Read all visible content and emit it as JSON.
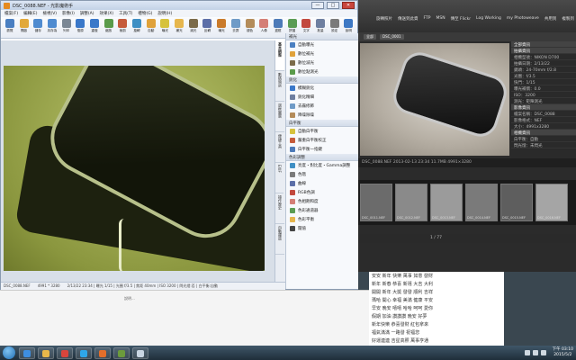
{
  "editor": {
    "title": "DSC_0088.NEF - 光影魔術手",
    "window_buttons": [
      "—",
      "□",
      "✕"
    ],
    "menu": [
      "檔案(F)",
      "編輯(E)",
      "檢視(V)",
      "影像(I)",
      "調整(A)",
      "效果(X)",
      "工具(T)",
      "禮物(G)",
      "說明(H)"
    ],
    "tools": [
      {
        "label": "瀏覽",
        "color": "#4a7fc1"
      },
      {
        "label": "開啟",
        "color": "#e2a93a"
      },
      {
        "label": "儲存",
        "color": "#4f8bd0"
      },
      {
        "label": "另存為",
        "color": "#4f8bd0"
      },
      {
        "label": "列印",
        "color": "#7b8794"
      },
      {
        "label": "復原",
        "color": "#3a78c9"
      },
      {
        "label": "重做",
        "color": "#3a78c9"
      },
      {
        "label": "縮放",
        "color": "#5a9b4a"
      },
      {
        "label": "裁剪",
        "color": "#c65b3b"
      },
      {
        "label": "旋轉",
        "color": "#3f8fc4"
      },
      {
        "label": "自動",
        "color": "#e0a23a"
      },
      {
        "label": "曝光",
        "color": "#d6c23d"
      },
      {
        "label": "補光",
        "color": "#e6b64d"
      },
      {
        "label": "減光",
        "color": "#7b6b4a"
      },
      {
        "label": "反轉",
        "color": "#5c6fa8"
      },
      {
        "label": "曝光",
        "color": "#ca7b2b"
      },
      {
        "label": "去霧",
        "color": "#6f9bc7"
      },
      {
        "label": "褪色",
        "color": "#b48c5a"
      },
      {
        "label": "人像",
        "color": "#d47e76"
      },
      {
        "label": "邊框",
        "color": "#4d7ab8"
      },
      {
        "label": "拼圖",
        "color": "#5b9c54"
      },
      {
        "label": "文字",
        "color": "#c2493e"
      },
      {
        "label": "批量",
        "color": "#6e7fa0"
      },
      {
        "label": "設定",
        "color": "#7a7a7a"
      },
      {
        "label": "說明",
        "color": "#3d78c4"
      }
    ],
    "vtabs": [
      "基本調整",
      "數碼暗房",
      "邊框圖層",
      "便捷工具",
      "EXIF",
      "操作歷史",
      "自動擺放"
    ],
    "panel": {
      "sections": [
        {
          "title": "補光",
          "items": [
            {
              "label": "自動曝光",
              "color": "#4a7fc1"
            },
            {
              "label": "數位補光",
              "color": "#e0a23a"
            },
            {
              "label": "數位減光",
              "color": "#7b6b4a"
            },
            {
              "label": "數位點測光",
              "color": "#5a9b4a"
            }
          ]
        },
        {
          "title": "銳化",
          "items": [
            {
              "label": "模糊銳化",
              "color": "#3a78c9"
            },
            {
              "label": "銳化精細",
              "color": "#6e7fa0"
            },
            {
              "label": "去霧修飾",
              "color": "#6f9bc7"
            },
            {
              "label": "降噪除噪",
              "color": "#b48c5a"
            }
          ]
        },
        {
          "title": "白平衡",
          "items": [
            {
              "label": "自動白平衡",
              "color": "#d6c23d"
            },
            {
              "label": "嚴重白平衡校正",
              "color": "#c65b3b"
            },
            {
              "label": "白平衡一指鍵",
              "color": "#4d7ab8"
            }
          ]
        },
        {
          "title": "色彩調整",
          "items": [
            {
              "label": "亮度・對比度・Gamma調整",
              "color": "#3f8fc4"
            },
            {
              "label": "色階",
              "color": "#7a7a7a"
            },
            {
              "label": "曲線",
              "color": "#5c6fa8"
            },
            {
              "label": "RGB色調",
              "color": "#c2493e"
            },
            {
              "label": "色相飽和度",
              "color": "#d47e76"
            },
            {
              "label": "色彩通道器",
              "color": "#5b9c54"
            },
            {
              "label": "色彩平衡",
              "color": "#e6b64d"
            },
            {
              "label": "閾值",
              "color": "#444444"
            }
          ]
        }
      ]
    },
    "status": [
      "DSC_0088.NEF",
      "4991 * 3280",
      "2/13/22 23:34 | 曝光 1/15 | 光圈 f/3.5 | 焦距 40mm | ISO 3200 | 閃光燈:否 | 白平衡:自動"
    ]
  },
  "viewer": {
    "toolbar": [
      "旋轉照片",
      "傳送到此資",
      "FTP",
      "MSN",
      "傳至 Flickr",
      "Log Working",
      "my Photoweave",
      "共用到",
      "複製到",
      "另外存"
    ],
    "subtabs": [
      "全部",
      "DSC_0001"
    ],
    "info": [
      {
        "text": "全部資訊",
        "header": true
      },
      {
        "text": "拍攝資訊",
        "header": true
      },
      {
        "text": "相機型號：NIKON D700",
        "header": false
      },
      {
        "text": "拍攝日期：2/13/22",
        "header": false
      },
      {
        "text": "鏡頭：24-70mm f/2.8",
        "header": false
      },
      {
        "text": "光圈：f/3.5",
        "header": false
      },
      {
        "text": "快門：1/15",
        "header": false
      },
      {
        "text": "曝光補償：0.0",
        "header": false
      },
      {
        "text": "ISO：3200",
        "header": false
      },
      {
        "text": "測光：矩陣測光",
        "header": false
      },
      {
        "text": "影像資訊",
        "header": true
      },
      {
        "text": "檔案名稱：DSC_0088",
        "header": false
      },
      {
        "text": "影像格式：NEF",
        "header": false
      },
      {
        "text": "大小：4991x3280",
        "header": false
      },
      {
        "text": "相機資訊",
        "header": true
      },
      {
        "text": "白平衡：自動",
        "header": false
      },
      {
        "text": "閃光燈：未閃光",
        "header": false
      }
    ],
    "filmbar": "DSC_0088.NEF 2013-02-13 23:34 11.7MB 4991×3280",
    "thumbs": [
      "DSC_0011.NEF",
      "DSC_0012.NEF",
      "DSC_0013.NEF",
      "DSC_0014.NEF",
      "DSC_0015.NEF",
      "DSC_0016.NEF"
    ],
    "pager": "1 / 77"
  },
  "chat": [
    {
      "text": "安安 新年 快樂 萬事 如意 發財"
    },
    {
      "text": "新年 新春 恭喜 新禧 大吉 大利"
    },
    {
      "text": "開開 新年 大獎 發發 順利 吉祥"
    },
    {
      "text": "瑪哈 開心 幸福 美滿 健康 平安"
    },
    {
      "text": "早安 晚安 嘻嘻 哈哈 呵呵 愛你"
    },
    {
      "text": "假期 加油 讚讚讚 晚安 好夢"
    },
    {
      "text": "新年快樂 恭喜發財 紅包拿來"
    },
    {
      "text": "福氣滿滿 一路發 祝福您"
    },
    {
      "text": "好運連連 吉星高照 萬事亨通"
    },
    {
      "text": "歡迎光臨 新的一年 更美好"
    }
  ],
  "bgwin": {
    "label": "說明..."
  },
  "taskbar": {
    "apps": [
      {
        "name": "ie-icon",
        "color": "#3e8ee0"
      },
      {
        "name": "folder-icon",
        "color": "#e8b84a"
      },
      {
        "name": "chrome-icon",
        "color": "#d9453c"
      },
      {
        "name": "skype-icon",
        "color": "#2ea6e8"
      },
      {
        "name": "media-icon",
        "color": "#e46e2a"
      },
      {
        "name": "photo-icon",
        "color": "#6c9b3c"
      },
      {
        "name": "window-icon",
        "color": "#c9d5e2"
      }
    ],
    "time": "下午 03:10",
    "date": "2015/5/2"
  }
}
